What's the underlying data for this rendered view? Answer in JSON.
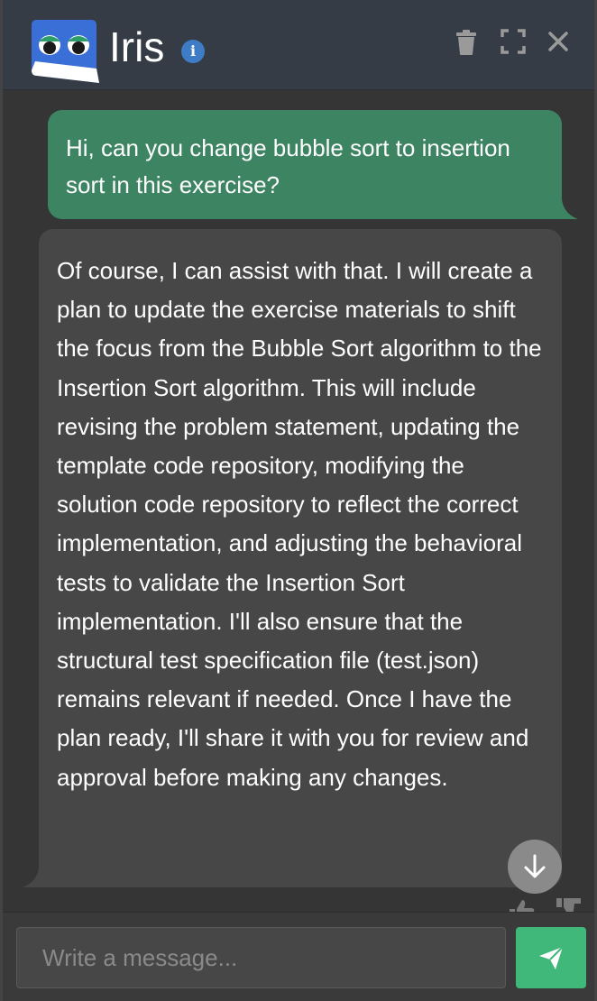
{
  "header": {
    "title": "Iris",
    "logo_icon": "iris-logo",
    "info_icon": "info-icon",
    "actions": [
      "trash-icon",
      "fullscreen-icon",
      "close-icon"
    ]
  },
  "messages": [
    {
      "role": "user",
      "text": "Hi, can you change bubble sort to insertion sort in this exercise?"
    },
    {
      "role": "assistant",
      "text": "Of course, I can assist with that. I will create a plan to update the exercise materials to shift the focus from the Bubble Sort algorithm to the Insertion Sort algorithm. This will include revising the problem statement, updating the template code repository, modifying the solution code repository to reflect the correct implementation, and adjusting the behavioral tests to validate the Insertion Sort implementation. I'll also ensure that the structural test specification file (test.json) remains relevant if needed. Once I have the plan ready, I'll share it with you for review and approval before making any changes."
    }
  ],
  "input": {
    "placeholder": "Write a message...",
    "value": ""
  },
  "colors": {
    "header_bg": "#353c45",
    "user_bubble": "#3d8462",
    "assistant_bubble": "#474747",
    "send_button": "#3fb87a"
  }
}
